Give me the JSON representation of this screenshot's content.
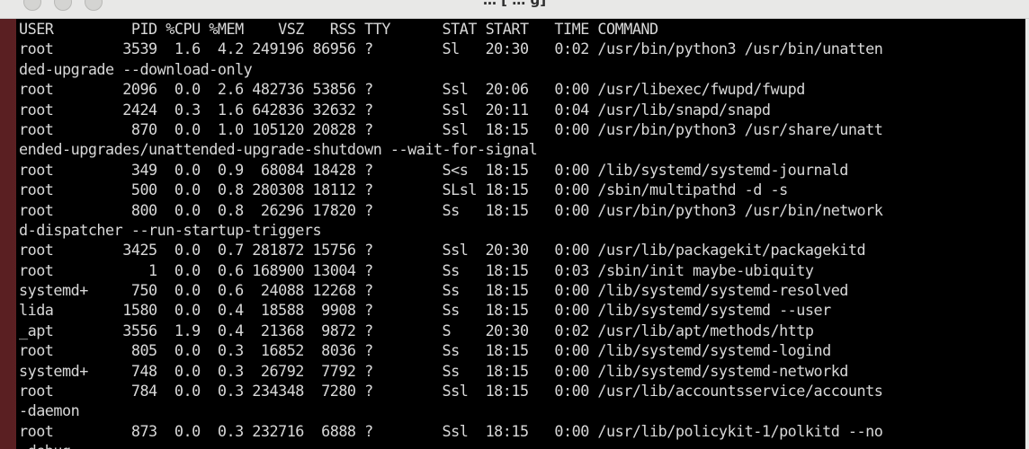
{
  "window": {
    "title": "… [ … g]"
  },
  "terminal": {
    "lines": [
      "USER         PID %CPU %MEM    VSZ   RSS TTY      STAT START   TIME COMMAND",
      "root        3539  1.6  4.2 249196 86956 ?        Sl   20:30   0:02 /usr/bin/python3 /usr/bin/unatten",
      "ded-upgrade --download-only",
      "root        2096  0.0  2.6 482736 53856 ?        Ssl  20:06   0:00 /usr/libexec/fwupd/fwupd",
      "root        2424  0.3  1.6 642836 32632 ?        Ssl  20:11   0:04 /usr/lib/snapd/snapd",
      "root         870  0.0  1.0 105120 20828 ?        Ssl  18:15   0:00 /usr/bin/python3 /usr/share/unatt",
      "ended-upgrades/unattended-upgrade-shutdown --wait-for-signal",
      "root         349  0.0  0.9  68084 18428 ?        S<s  18:15   0:00 /lib/systemd/systemd-journald",
      "root         500  0.0  0.8 280308 18112 ?        SLsl 18:15   0:00 /sbin/multipathd -d -s",
      "root         800  0.0  0.8  26296 17820 ?        Ss   18:15   0:00 /usr/bin/python3 /usr/bin/network",
      "d-dispatcher --run-startup-triggers",
      "root        3425  0.0  0.7 281872 15756 ?        Ssl  20:30   0:00 /usr/lib/packagekit/packagekitd",
      "root           1  0.0  0.6 168900 13004 ?        Ss   18:15   0:03 /sbin/init maybe-ubiquity",
      "systemd+     750  0.0  0.6  24088 12268 ?        Ss   18:15   0:00 /lib/systemd/systemd-resolved",
      "lida        1580  0.0  0.4  18588  9908 ?        Ss   18:15   0:00 /lib/systemd/systemd --user",
      "_apt        3556  1.9  0.4  21368  9872 ?        S    20:30   0:02 /usr/lib/apt/methods/http",
      "root         805  0.0  0.3  16852  8036 ?        Ss   18:15   0:00 /lib/systemd/systemd-logind",
      "systemd+     748  0.0  0.3  26792  7792 ?        Ss   18:15   0:00 /lib/systemd/systemd-networkd",
      "root         784  0.0  0.3 234348  7280 ?        Ssl  18:15   0:00 /usr/lib/accountsservice/accounts",
      "-daemon",
      "root         873  0.0  0.3 232716  6888 ?        Ssl  18:15   0:00 /usr/lib/policykit-1/polkitd --no",
      "-debug"
    ]
  }
}
